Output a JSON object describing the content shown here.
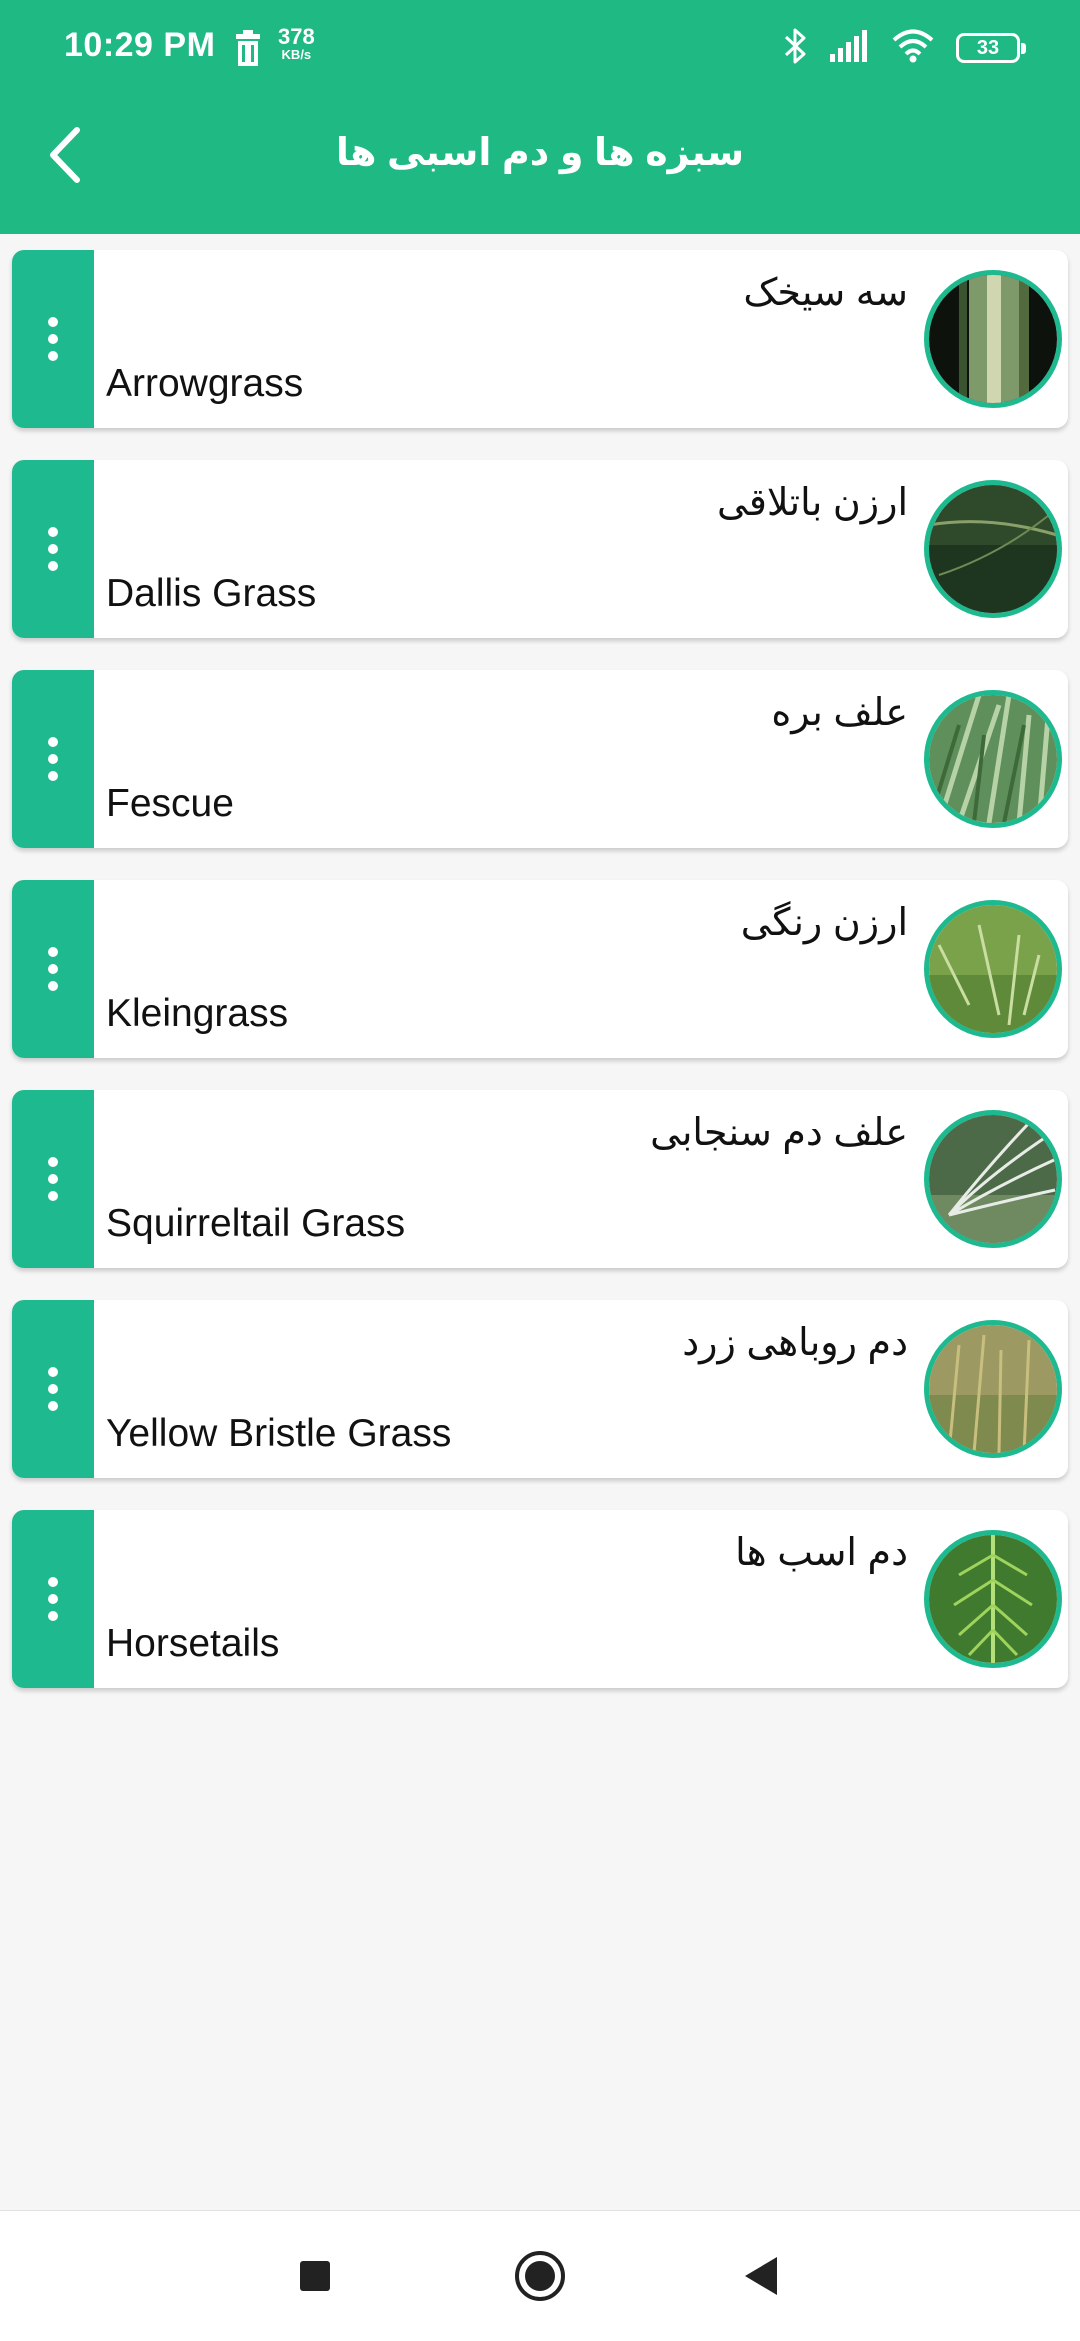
{
  "status_bar": {
    "time": "10:29 PM",
    "speed_value": "378",
    "speed_unit": "KB/s",
    "battery": "33"
  },
  "header": {
    "title": "سبزه ها و دم اسبی ها",
    "back_icon": "chevron-left-icon"
  },
  "items": [
    {
      "fa": "سه سیخک",
      "en": "Arrowgrass"
    },
    {
      "fa": "ارزن باتلاقی",
      "en": "Dallis Grass"
    },
    {
      "fa": "علف بره",
      "en": "Fescue"
    },
    {
      "fa": "ارزن رنگی",
      "en": "Kleingrass"
    },
    {
      "fa": "علف دم سنجابی",
      "en": "Squirreltail Grass"
    },
    {
      "fa": "دم روباهی زرد",
      "en": "Yellow Bristle Grass"
    },
    {
      "fa": "دم اسب ها",
      "en": "Horsetails"
    }
  ],
  "colors": {
    "accent": "#1fb983",
    "card_menu": "#1fb98f",
    "background": "#f6f6f6"
  },
  "nav": {
    "recents_icon": "square-icon",
    "home_icon": "circle-icon",
    "back_icon": "triangle-back-icon"
  }
}
